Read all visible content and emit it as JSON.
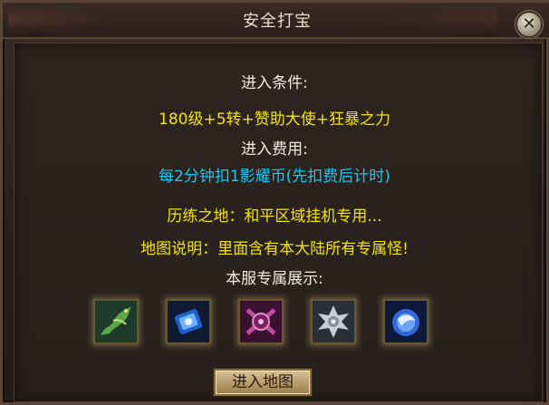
{
  "window": {
    "title": "安全打宝",
    "close_glyph": "✕"
  },
  "info": {
    "entry_condition_label": "进入条件:",
    "entry_condition_value": "180级+5转+赞助大使+狂暴之力",
    "entry_cost_label": "进入费用:",
    "entry_cost_value": "每2分钟扣1影耀币(先扣费后计时)",
    "training_ground": "历练之地：和平区域挂机专用...",
    "map_description": "地图说明：里面含有本大陆所有专属怪!",
    "exclusive_showcase_label": "本服专属展示:"
  },
  "items": [
    {
      "icon": "dragon-icon"
    },
    {
      "icon": "blue-scroll-icon"
    },
    {
      "icon": "purple-rune-icon"
    },
    {
      "icon": "silver-emblem-icon"
    },
    {
      "icon": "blue-orb-icon"
    }
  ],
  "buttons": {
    "enter_map": "进入地图"
  },
  "colors": {
    "label": "#f0ebe2",
    "highlight": "#f2e400",
    "cost": "#19c7f0"
  }
}
